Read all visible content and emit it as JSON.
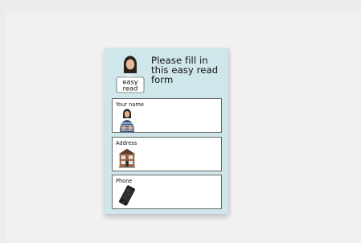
{
  "form": {
    "title": "Please fill in this easy read form",
    "logo_text_line1": "easy",
    "logo_text_line2": "read",
    "fields": [
      {
        "label": "Your name",
        "icon": "person-icon"
      },
      {
        "label": "Address",
        "icon": "house-icon"
      },
      {
        "label": "Phone",
        "icon": "mobile-phone-icon"
      }
    ]
  }
}
